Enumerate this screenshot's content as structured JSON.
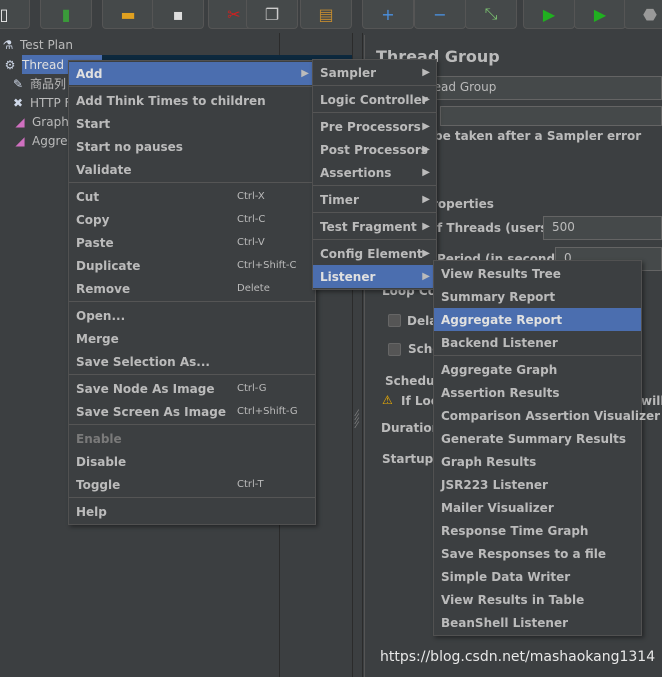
{
  "toolbar": {
    "buttons": [
      {
        "icon": "new-icon",
        "glyph": "▯",
        "color": "#eeeeee"
      },
      {
        "icon": "templates-icon",
        "glyph": "▮",
        "color": "#3a9a3a"
      },
      {
        "icon": "open-icon",
        "glyph": "▬",
        "color": "#e0a020"
      },
      {
        "icon": "save-icon",
        "glyph": "▪",
        "color": "#dddddd"
      },
      {
        "icon": "cut-icon",
        "glyph": "✂",
        "color": "#d02020"
      },
      {
        "icon": "copy-icon",
        "glyph": "❐",
        "color": "#cccccc"
      },
      {
        "icon": "paste-icon",
        "glyph": "▤",
        "color": "#c08a30"
      },
      {
        "icon": "expand-icon",
        "glyph": "+",
        "color": "#4a90e0"
      },
      {
        "icon": "collapse-icon",
        "glyph": "−",
        "color": "#4a90e0"
      },
      {
        "icon": "toggle-icon",
        "glyph": "⤡",
        "color": "#7ac070"
      },
      {
        "icon": "start-icon",
        "glyph": "▶",
        "color": "#20b020"
      },
      {
        "icon": "start-no-pauses-icon",
        "glyph": "▶",
        "color": "#20b020"
      },
      {
        "icon": "stop-icon",
        "glyph": "⬣",
        "color": "#999999"
      }
    ]
  },
  "tree": {
    "items": [
      {
        "label": "Test Plan",
        "icon": "test-plan-icon",
        "glyph": "⚗"
      },
      {
        "label": "Thread G",
        "icon": "gear-icon",
        "glyph": "⚙"
      },
      {
        "label": "商品列",
        "icon": "pipette-icon",
        "glyph": "✎"
      },
      {
        "label": "HTTP F",
        "icon": "tools-icon",
        "glyph": "✖"
      },
      {
        "label": "Graph",
        "icon": "graph-icon",
        "glyph": "◢"
      },
      {
        "label": "Aggreg",
        "icon": "graph-icon",
        "glyph": "◢"
      }
    ]
  },
  "right": {
    "title": "Thread Group",
    "name_value": "read Group",
    "comments_label": ":",
    "error_action_label": "be taken after a Sampler error",
    "properties_label": "roperties",
    "threads_label": "f Threads (users):",
    "threads_value": "500",
    "rampup_label": "Period (in seconds):",
    "rampup_value": "0",
    "loop_label": "Loop Cou",
    "delay_label": "Dela",
    "scheduler_label": "Sche",
    "scheduler_group_label": "Schedule",
    "warning_text": "If Loo",
    "warning_tail": "will",
    "duration_label": "Duration (",
    "startup_label": "Startup d"
  },
  "context_menu": {
    "items": [
      {
        "label": "Add",
        "arrow": true,
        "highlighted": true
      },
      {
        "sep": true
      },
      {
        "label": "Add Think Times to children"
      },
      {
        "label": "Start"
      },
      {
        "label": "Start no pauses"
      },
      {
        "label": "Validate"
      },
      {
        "sep": true
      },
      {
        "label": "Cut",
        "shortcut": "Ctrl-X"
      },
      {
        "label": "Copy",
        "shortcut": "Ctrl-C"
      },
      {
        "label": "Paste",
        "shortcut": "Ctrl-V"
      },
      {
        "label": "Duplicate",
        "shortcut": "Ctrl+Shift-C"
      },
      {
        "label": "Remove",
        "shortcut": "Delete"
      },
      {
        "sep": true
      },
      {
        "label": "Open..."
      },
      {
        "label": "Merge"
      },
      {
        "label": "Save Selection As..."
      },
      {
        "sep": true
      },
      {
        "label": "Save Node As Image",
        "shortcut": "Ctrl-G"
      },
      {
        "label": "Save Screen As Image",
        "shortcut": "Ctrl+Shift-G"
      },
      {
        "sep": true
      },
      {
        "label": "Enable",
        "disabled": true
      },
      {
        "label": "Disable"
      },
      {
        "label": "Toggle",
        "shortcut": "Ctrl-T"
      },
      {
        "sep": true
      },
      {
        "label": "Help"
      }
    ]
  },
  "add_menu": {
    "items": [
      {
        "label": "Sampler",
        "arrow": true
      },
      {
        "sep": true
      },
      {
        "label": "Logic Controller",
        "arrow": true
      },
      {
        "sep": true
      },
      {
        "label": "Pre Processors",
        "arrow": true
      },
      {
        "label": "Post Processors",
        "arrow": true
      },
      {
        "label": "Assertions",
        "arrow": true
      },
      {
        "sep": true
      },
      {
        "label": "Timer",
        "arrow": true
      },
      {
        "sep": true
      },
      {
        "label": "Test Fragment",
        "arrow": true
      },
      {
        "sep": true
      },
      {
        "label": "Config Element",
        "arrow": true
      },
      {
        "label": "Listener",
        "arrow": true,
        "highlighted": true
      }
    ]
  },
  "listener_menu": {
    "items": [
      {
        "label": "View Results Tree"
      },
      {
        "label": "Summary Report"
      },
      {
        "label": "Aggregate Report",
        "highlighted": true
      },
      {
        "label": "Backend Listener"
      },
      {
        "sep": true
      },
      {
        "label": "Aggregate Graph"
      },
      {
        "label": "Assertion Results"
      },
      {
        "label": "Comparison Assertion Visualizer"
      },
      {
        "label": "Generate Summary Results"
      },
      {
        "label": "Graph Results"
      },
      {
        "label": "JSR223 Listener"
      },
      {
        "label": "Mailer Visualizer"
      },
      {
        "label": "Response Time Graph"
      },
      {
        "label": "Save Responses to a file"
      },
      {
        "label": "Simple Data Writer"
      },
      {
        "label": "View Results in Table"
      },
      {
        "label": "BeanShell Listener"
      }
    ]
  },
  "watermark": "https://blog.csdn.net/mashaokang1314",
  "colors": {
    "background": "#3c3f41",
    "highlight": "#4b6eaf",
    "text": "#bbbbbb"
  }
}
